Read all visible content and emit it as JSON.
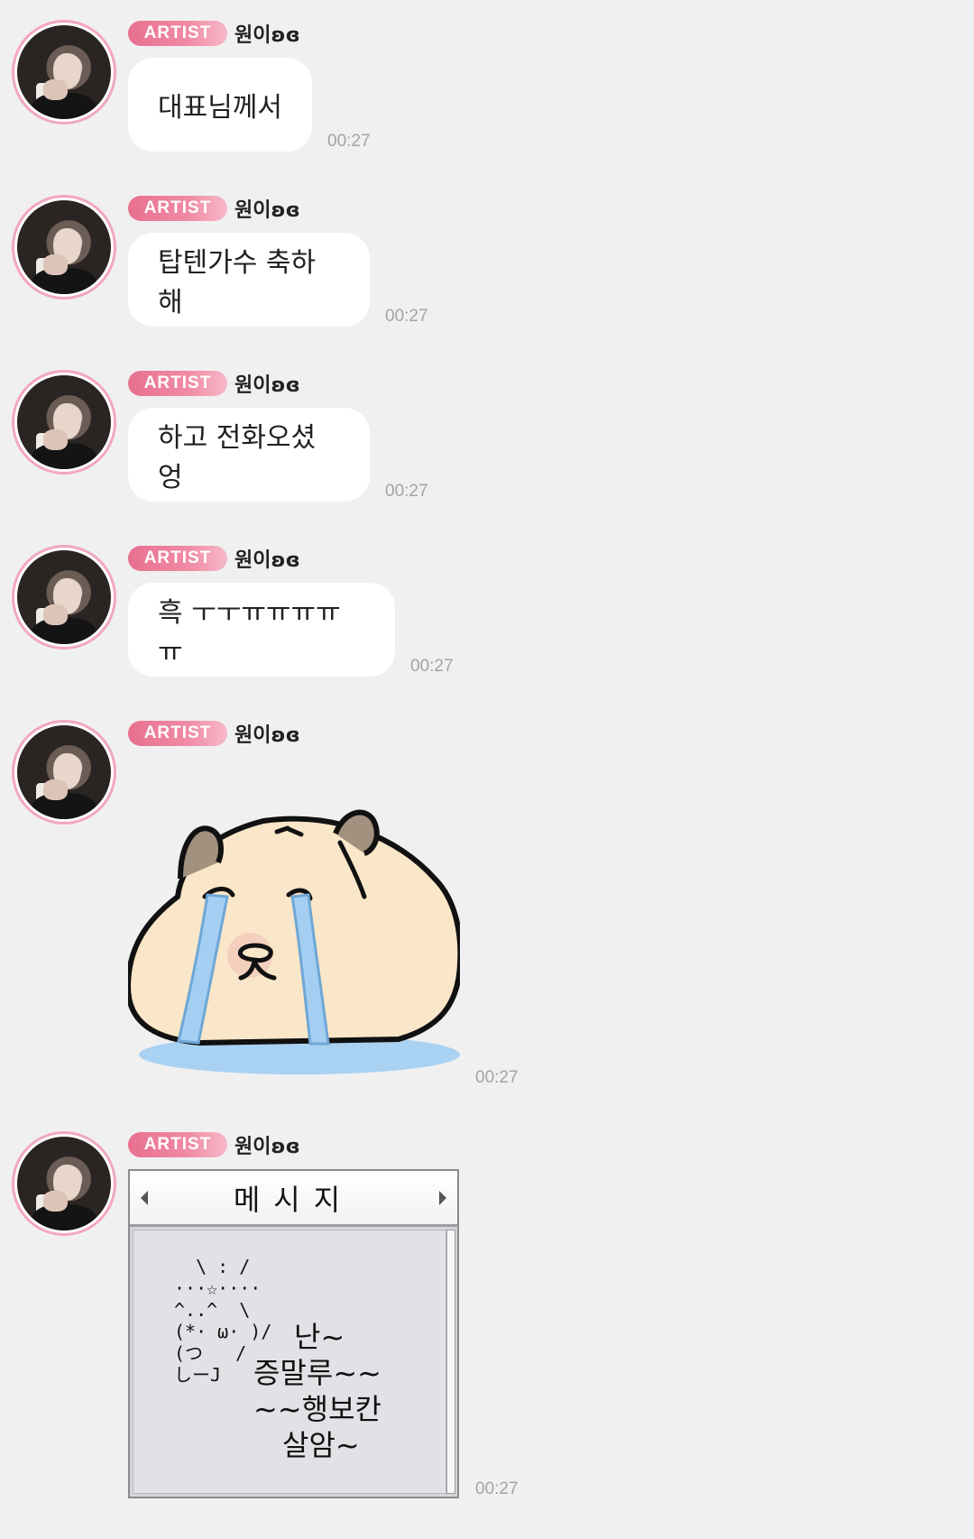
{
  "sender": {
    "badge": "ARTIST",
    "name": "원이ʚɞ"
  },
  "messages": [
    {
      "text": "대표님께서",
      "time": "00:27"
    },
    {
      "text": "탑텐가수 축하해",
      "time": "00:27"
    },
    {
      "text": "하고 전화오셨엉",
      "time": "00:27"
    },
    {
      "text": "흑 ㅜㅜㅠㅠㅠㅠㅠ",
      "time": "00:27"
    },
    {
      "sticker": "crying-capybara-sticker",
      "time": "00:27"
    },
    {
      "card": {
        "title": "메시지",
        "art": "  \\ : /\n···☆····\n^..^  \\\n(*· ω· )/\n(つ   /\nしーJ",
        "text_lines": [
          "난~",
          "증말루~~",
          "~~행보칸",
          "살암~"
        ]
      },
      "time": "00:27"
    }
  ],
  "colors": {
    "background": "#f0f0f1",
    "badge": "#e8708f",
    "avatar_ring": "#f2a7bd",
    "bubble": "#ffffff",
    "time": "#a4a4a4"
  }
}
